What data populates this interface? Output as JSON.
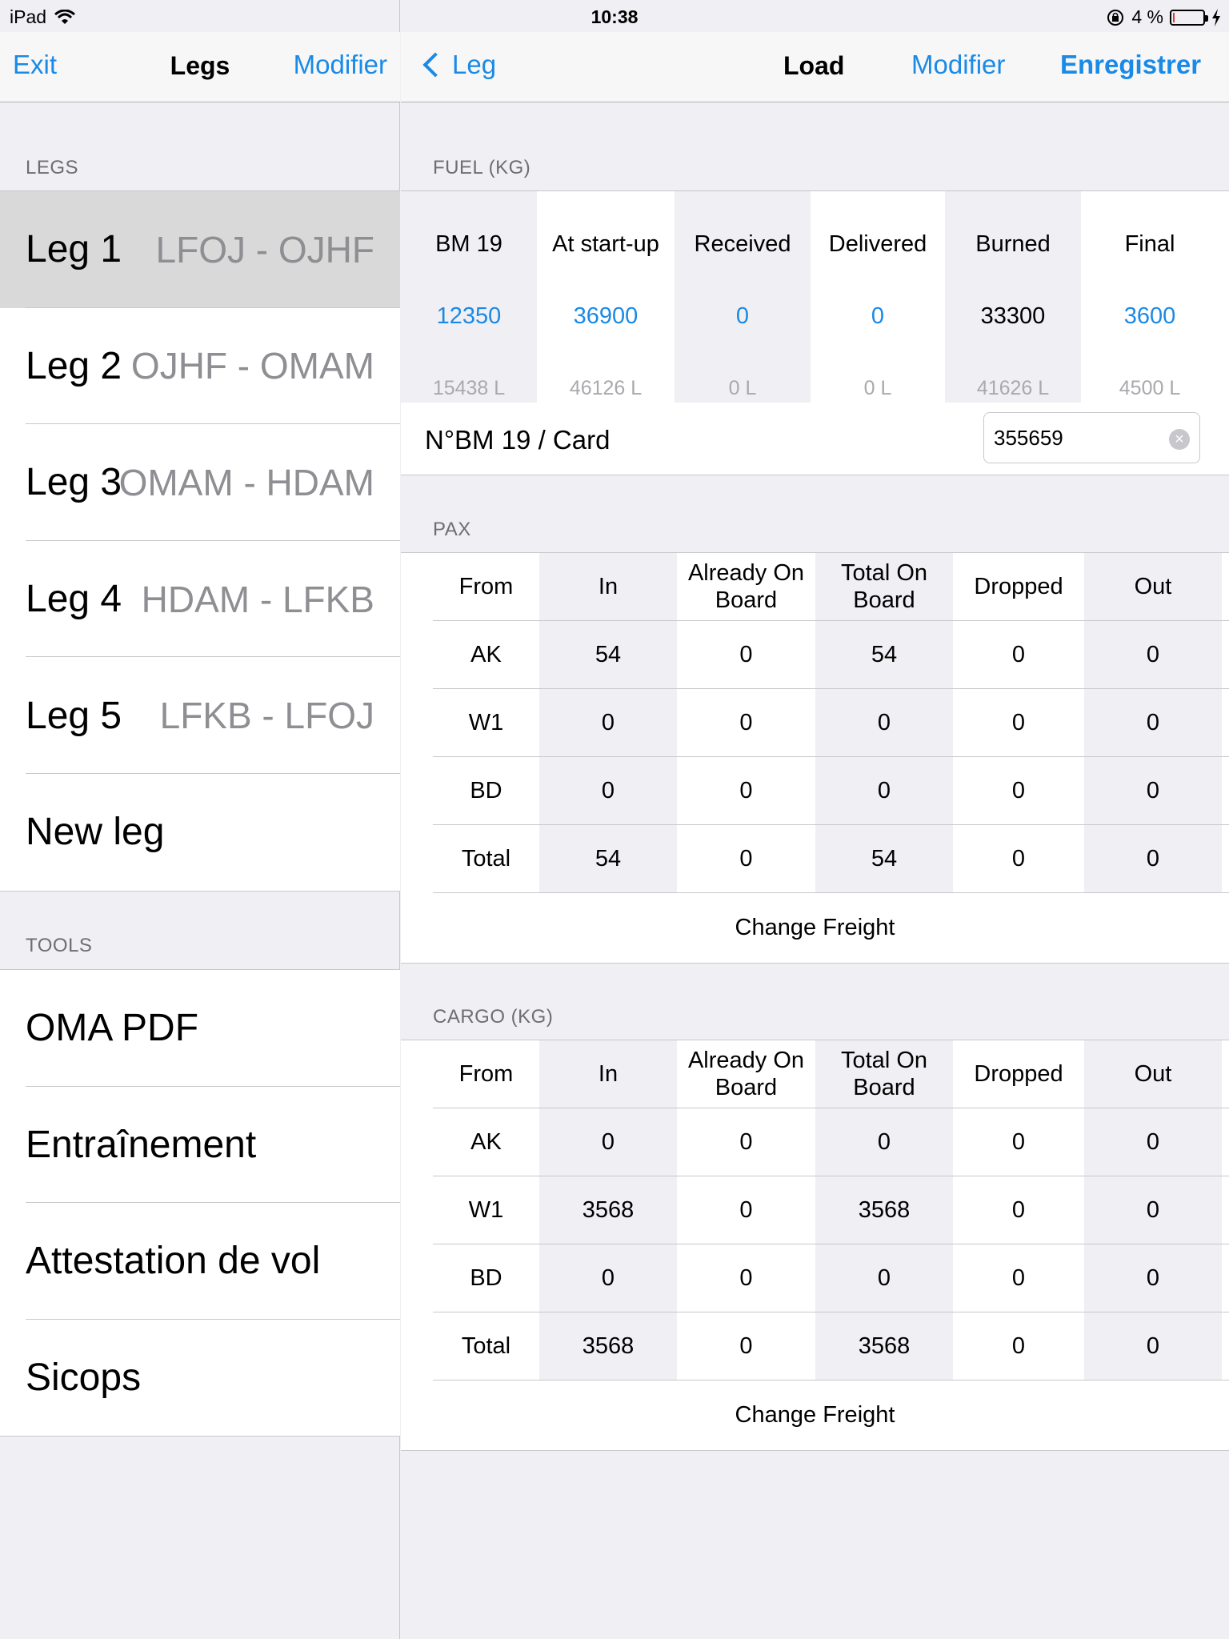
{
  "status": {
    "device": "iPad",
    "time": "10:38",
    "battery": "4 %",
    "battery_level": 0.04
  },
  "left": {
    "nav": {
      "left_button": "Exit",
      "title": "Legs",
      "right_button": "Modifier"
    },
    "legs_header": "LEGS",
    "legs": [
      {
        "name": "Leg 1",
        "route": "LFOJ - OJHF"
      },
      {
        "name": "Leg 2",
        "route": "OJHF - OMAM"
      },
      {
        "name": "Leg 3",
        "route": "OMAM - HDAM"
      },
      {
        "name": "Leg 4",
        "route": "HDAM - LFKB"
      },
      {
        "name": "Leg 5",
        "route": "LFKB - LFOJ"
      }
    ],
    "new_leg": "New leg",
    "tools_header": "TOOLS",
    "tools": [
      "OMA PDF",
      "Entraînement",
      "Attestation de vol",
      "Sicops"
    ]
  },
  "right": {
    "nav": {
      "back": "Leg",
      "title": "Load",
      "modify": "Modifier",
      "save": "Enregistrer"
    },
    "fuel": {
      "header": "FUEL (KG)",
      "columns": [
        {
          "label": "BM 19",
          "value": "12350",
          "liters": "15438 L"
        },
        {
          "label": "At start-up",
          "value": "36900",
          "liters": "46126 L"
        },
        {
          "label": "Received",
          "value": "0",
          "liters": "0 L"
        },
        {
          "label": "Delivered",
          "value": "0",
          "liters": "0 L"
        },
        {
          "label": "Burned",
          "value": "33300",
          "liters": "41626 L"
        },
        {
          "label": "Final",
          "value": "3600",
          "liters": "4500 L"
        }
      ],
      "card_label": "N°BM 19 / Card",
      "card_value": "355659"
    },
    "pax": {
      "header": "PAX",
      "columns": [
        "From",
        "In",
        "Already On Board",
        "Total On Board",
        "Dropped",
        "Out"
      ],
      "rows": [
        [
          "AK",
          "54",
          "0",
          "54",
          "0",
          "0"
        ],
        [
          "W1",
          "0",
          "0",
          "0",
          "0",
          "0"
        ],
        [
          "BD",
          "0",
          "0",
          "0",
          "0",
          "0"
        ],
        [
          "Total",
          "54",
          "0",
          "54",
          "0",
          "0"
        ]
      ],
      "action": "Change Freight"
    },
    "cargo": {
      "header": "CARGO (KG)",
      "columns": [
        "From",
        "In",
        "Already On Board",
        "Total On Board",
        "Dropped",
        "Out"
      ],
      "rows": [
        [
          "AK",
          "0",
          "0",
          "0",
          "0",
          "0"
        ],
        [
          "W1",
          "3568",
          "0",
          "3568",
          "0",
          "0"
        ],
        [
          "BD",
          "0",
          "0",
          "0",
          "0",
          "0"
        ],
        [
          "Total",
          "3568",
          "0",
          "3568",
          "0",
          "0"
        ]
      ],
      "action": "Change Freight"
    }
  }
}
